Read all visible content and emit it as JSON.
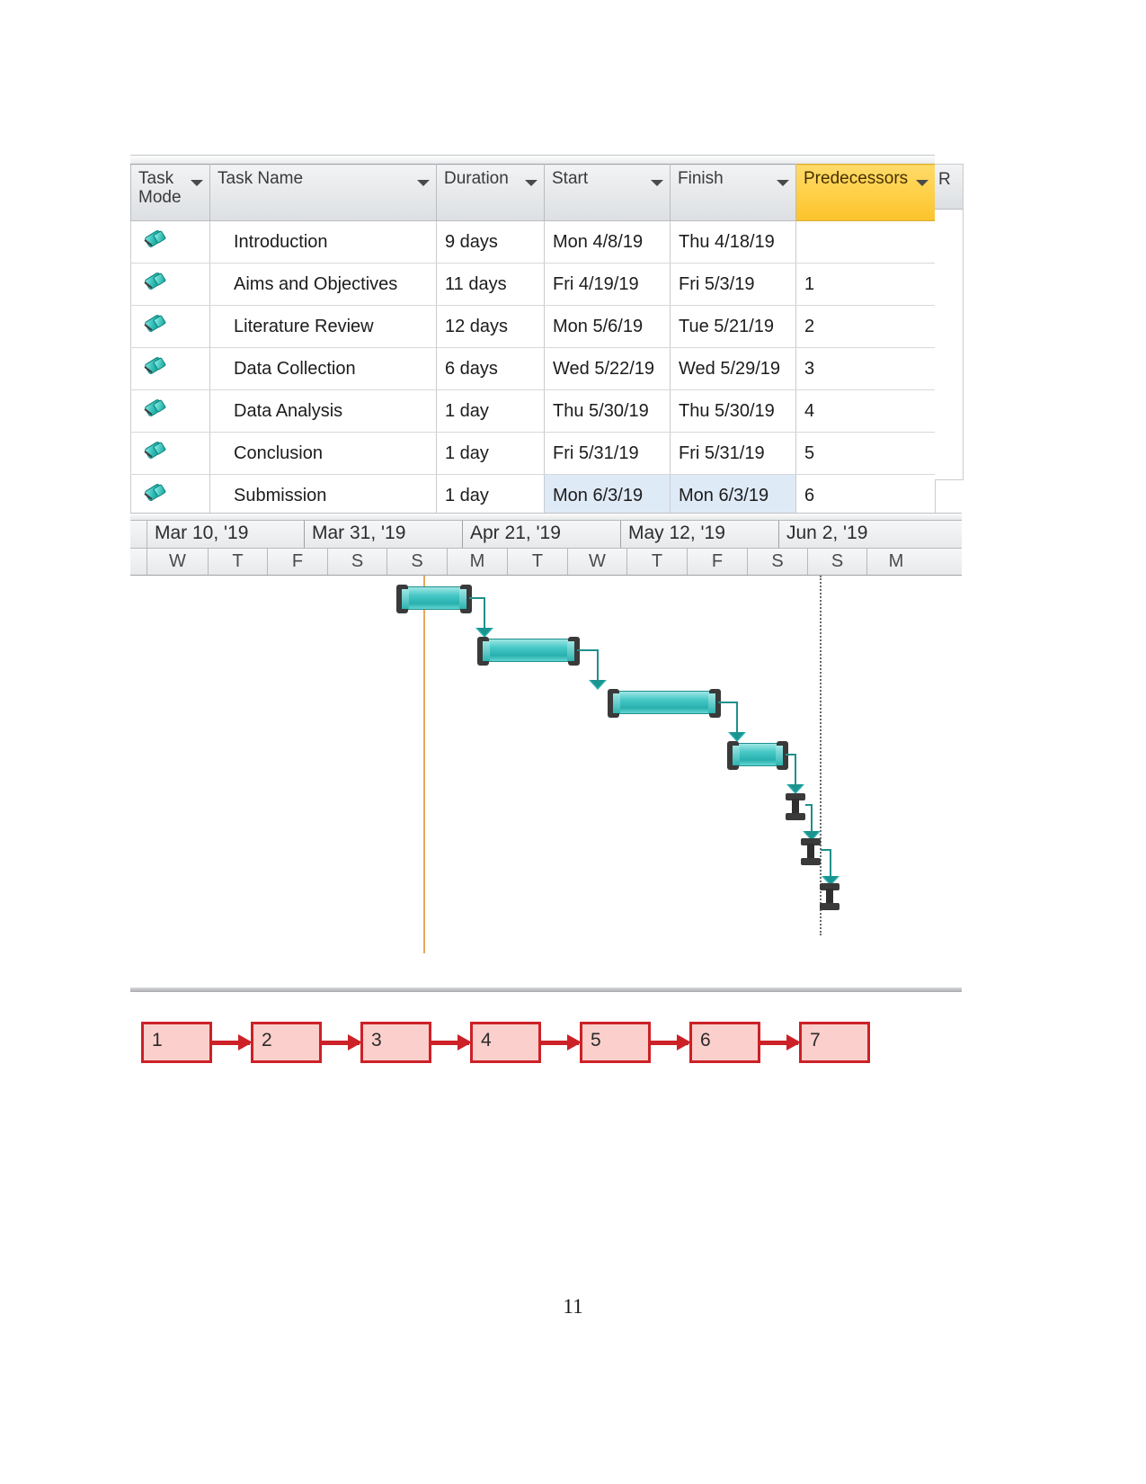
{
  "document": {
    "page_number": "11"
  },
  "task_table": {
    "columns": [
      {
        "key": "task_mode",
        "label": "Task Mode",
        "has_filter": true,
        "highlight": false
      },
      {
        "key": "task_name",
        "label": "Task Name",
        "has_filter": true,
        "highlight": false
      },
      {
        "key": "duration",
        "label": "Duration",
        "has_filter": true,
        "highlight": false
      },
      {
        "key": "start",
        "label": "Start",
        "has_filter": true,
        "highlight": false
      },
      {
        "key": "finish",
        "label": "Finish",
        "has_filter": true,
        "highlight": false
      },
      {
        "key": "predecessors",
        "label": "Predecessors",
        "has_filter": true,
        "highlight": true
      }
    ],
    "cut_off_column_label": "R",
    "mode_icon": "push-pin-icon",
    "rows": [
      {
        "id": 1,
        "mode_icon": "push-pin-icon",
        "name": "Introduction",
        "duration": "9 days",
        "start": "Mon 4/8/19",
        "finish": "Thu 4/18/19",
        "predecessors": "",
        "selected": false
      },
      {
        "id": 2,
        "mode_icon": "push-pin-icon",
        "name": "Aims and Objectives",
        "duration": "11 days",
        "start": "Fri 4/19/19",
        "finish": "Fri 5/3/19",
        "predecessors": "1",
        "selected": false
      },
      {
        "id": 3,
        "mode_icon": "push-pin-icon",
        "name": "Literature Review",
        "duration": "12 days",
        "start": "Mon 5/6/19",
        "finish": "Tue 5/21/19",
        "predecessors": "2",
        "selected": false
      },
      {
        "id": 4,
        "mode_icon": "push-pin-icon",
        "name": "Data Collection",
        "duration": "6 days",
        "start": "Wed 5/22/19",
        "finish": "Wed 5/29/19",
        "predecessors": "3",
        "selected": false
      },
      {
        "id": 5,
        "mode_icon": "push-pin-icon",
        "name": "Data Analysis",
        "duration": "1 day",
        "start": "Thu 5/30/19",
        "finish": "Thu 5/30/19",
        "predecessors": "4",
        "selected": false
      },
      {
        "id": 6,
        "mode_icon": "push-pin-icon",
        "name": "Conclusion",
        "duration": "1 day",
        "start": "Fri 5/31/19",
        "finish": "Fri 5/31/19",
        "predecessors": "5",
        "selected": false
      },
      {
        "id": 7,
        "mode_icon": "push-pin-icon",
        "name": "Submission",
        "duration": "1 day",
        "start": "Mon 6/3/19",
        "finish": "Mon 6/3/19",
        "predecessors": "6",
        "selected": true
      }
    ]
  },
  "chart_data": {
    "type": "bar",
    "title": "Gantt Chart Timeline",
    "timeline_weeks": [
      "Mar 10, '19",
      "Mar 31, '19",
      "Apr 21, '19",
      "May 12, '19",
      "Jun 2, '19"
    ],
    "timeline_days": [
      "W",
      "T",
      "F",
      "S",
      "S",
      "M",
      "T",
      "W",
      "T",
      "F",
      "S",
      "S",
      "M"
    ],
    "xlabel": "",
    "ylabel": "",
    "grid": false,
    "legend": "none",
    "bars": [
      {
        "task": "Introduction",
        "start": "Mon 4/8/19",
        "finish": "Thu 4/18/19",
        "duration_days": 9,
        "style": "task"
      },
      {
        "task": "Aims and Objectives",
        "start": "Fri 4/19/19",
        "finish": "Fri 5/3/19",
        "duration_days": 11,
        "style": "task"
      },
      {
        "task": "Literature Review",
        "start": "Mon 5/6/19",
        "finish": "Tue 5/21/19",
        "duration_days": 12,
        "style": "task"
      },
      {
        "task": "Data Collection",
        "start": "Wed 5/22/19",
        "finish": "Wed 5/29/19",
        "duration_days": 6,
        "style": "task"
      },
      {
        "task": "Data Analysis",
        "start": "Thu 5/30/19",
        "finish": "Thu 5/30/19",
        "duration_days": 1,
        "style": "single-day"
      },
      {
        "task": "Conclusion",
        "start": "Fri 5/31/19",
        "finish": "Fri 5/31/19",
        "duration_days": 1,
        "style": "single-day"
      },
      {
        "task": "Submission",
        "start": "Mon 6/3/19",
        "finish": "Mon 6/3/19",
        "duration_days": 1,
        "style": "single-day"
      }
    ],
    "colors": {
      "bar_fill": "#3cc4c1",
      "bar_cap": "#3a3a3a",
      "link_arrow": "#2ab2ae",
      "today_line": "#e8a85a",
      "status_line": "#6a6a6a",
      "predecessor_header": "#ffcf45"
    }
  },
  "network_diagram": {
    "nodes": [
      "1",
      "2",
      "3",
      "4",
      "5",
      "6",
      "7"
    ],
    "arrow_color": "#cc2127",
    "node_fill": "#fbcfcb"
  }
}
